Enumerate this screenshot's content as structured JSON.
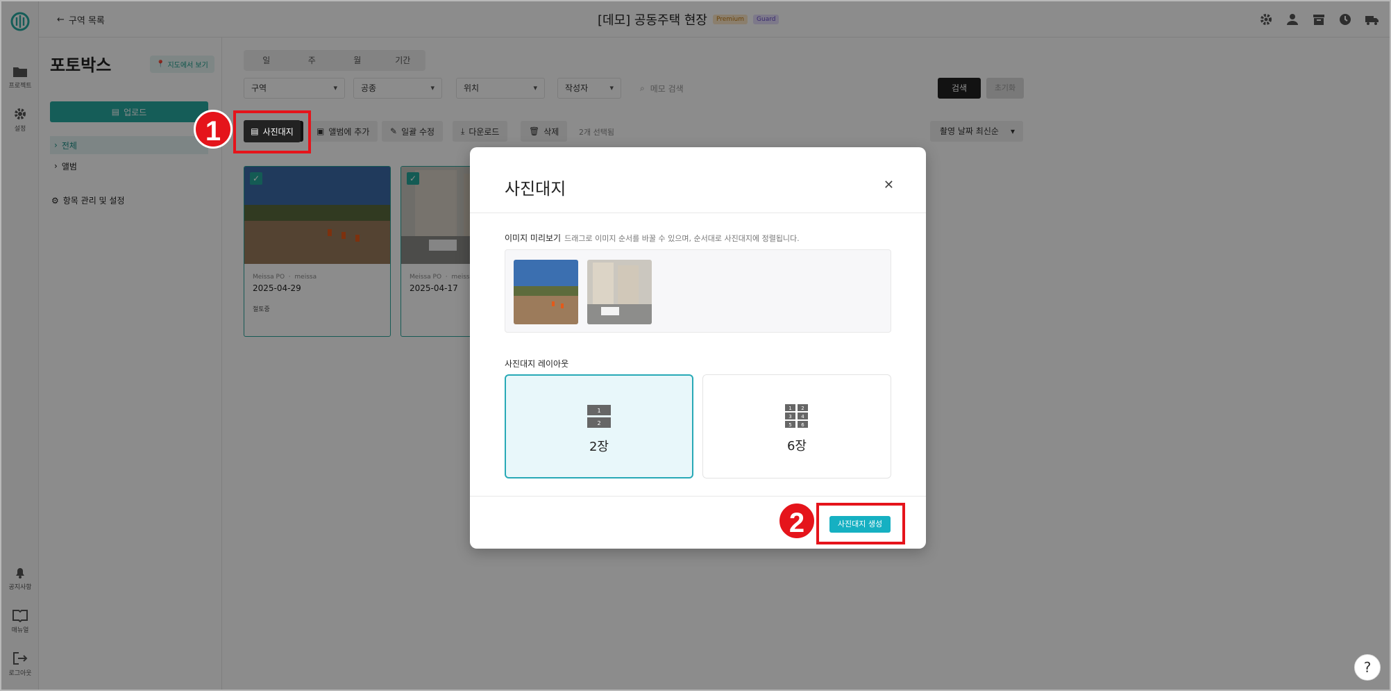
{
  "rail": {
    "items": [
      {
        "label": "프로젝트",
        "icon": "folder-icon"
      },
      {
        "label": "설정",
        "icon": "gear-icon"
      },
      {
        "label": "공지사항",
        "icon": "bell-icon"
      },
      {
        "label": "매뉴얼",
        "icon": "book-icon"
      },
      {
        "label": "로그아웃",
        "icon": "logout-icon"
      }
    ]
  },
  "topbar": {
    "back_label": "구역 목록",
    "title": "[데모] 공동주택 현장",
    "badges": [
      "Premium",
      "Guard"
    ]
  },
  "sidebar": {
    "title": "포토박스",
    "map_link": "지도에서 보기",
    "upload_label": "업로드",
    "tree": [
      "전체",
      "앨범"
    ],
    "settings_label": "항목 관리 및 설정"
  },
  "main": {
    "period_tabs": [
      "일",
      "주",
      "월",
      "기간"
    ],
    "filters": [
      "구역",
      "공종",
      "위치",
      "작성자"
    ],
    "search_placeholder": "메모 검색",
    "search_button": "검색",
    "reset_button": "초기화",
    "toolbar": {
      "photo_sheet": "사진대지",
      "add_album": "앨범에 추가",
      "bulk_edit": "일괄 수정",
      "download": "다운로드",
      "delete": "삭제",
      "selected_count": "2개 선택됨"
    },
    "sort_label": "촬영 날짜 최신순",
    "cards": [
      {
        "author": "Meissa PO",
        "user": "meissa",
        "date": "2025-04-29",
        "tag": "절토중"
      },
      {
        "author": "Meissa PO",
        "user": "meissa",
        "date": "2025-04-17",
        "tag": ""
      }
    ]
  },
  "modal": {
    "title": "사진대지",
    "preview_label": "이미지 미리보기",
    "preview_hint": "드래그로 이미지 순서를 바꿀 수 있으며, 순서대로 사진대지에 정렬됩니다.",
    "layout_label": "사진대지 레이아웃",
    "layouts": [
      {
        "label": "2장",
        "cells": [
          "1",
          "2"
        ],
        "selected": true
      },
      {
        "label": "6장",
        "cells": [
          "1",
          "2",
          "3",
          "4",
          "5",
          "6"
        ],
        "selected": false
      }
    ],
    "create_button": "사진대지 생성"
  },
  "annotations": {
    "step1": "1",
    "step2": "2"
  },
  "help_label": "?",
  "colors": {
    "accent": "#27a9a0",
    "marker": "#e5141b",
    "create": "#16b0c2"
  }
}
